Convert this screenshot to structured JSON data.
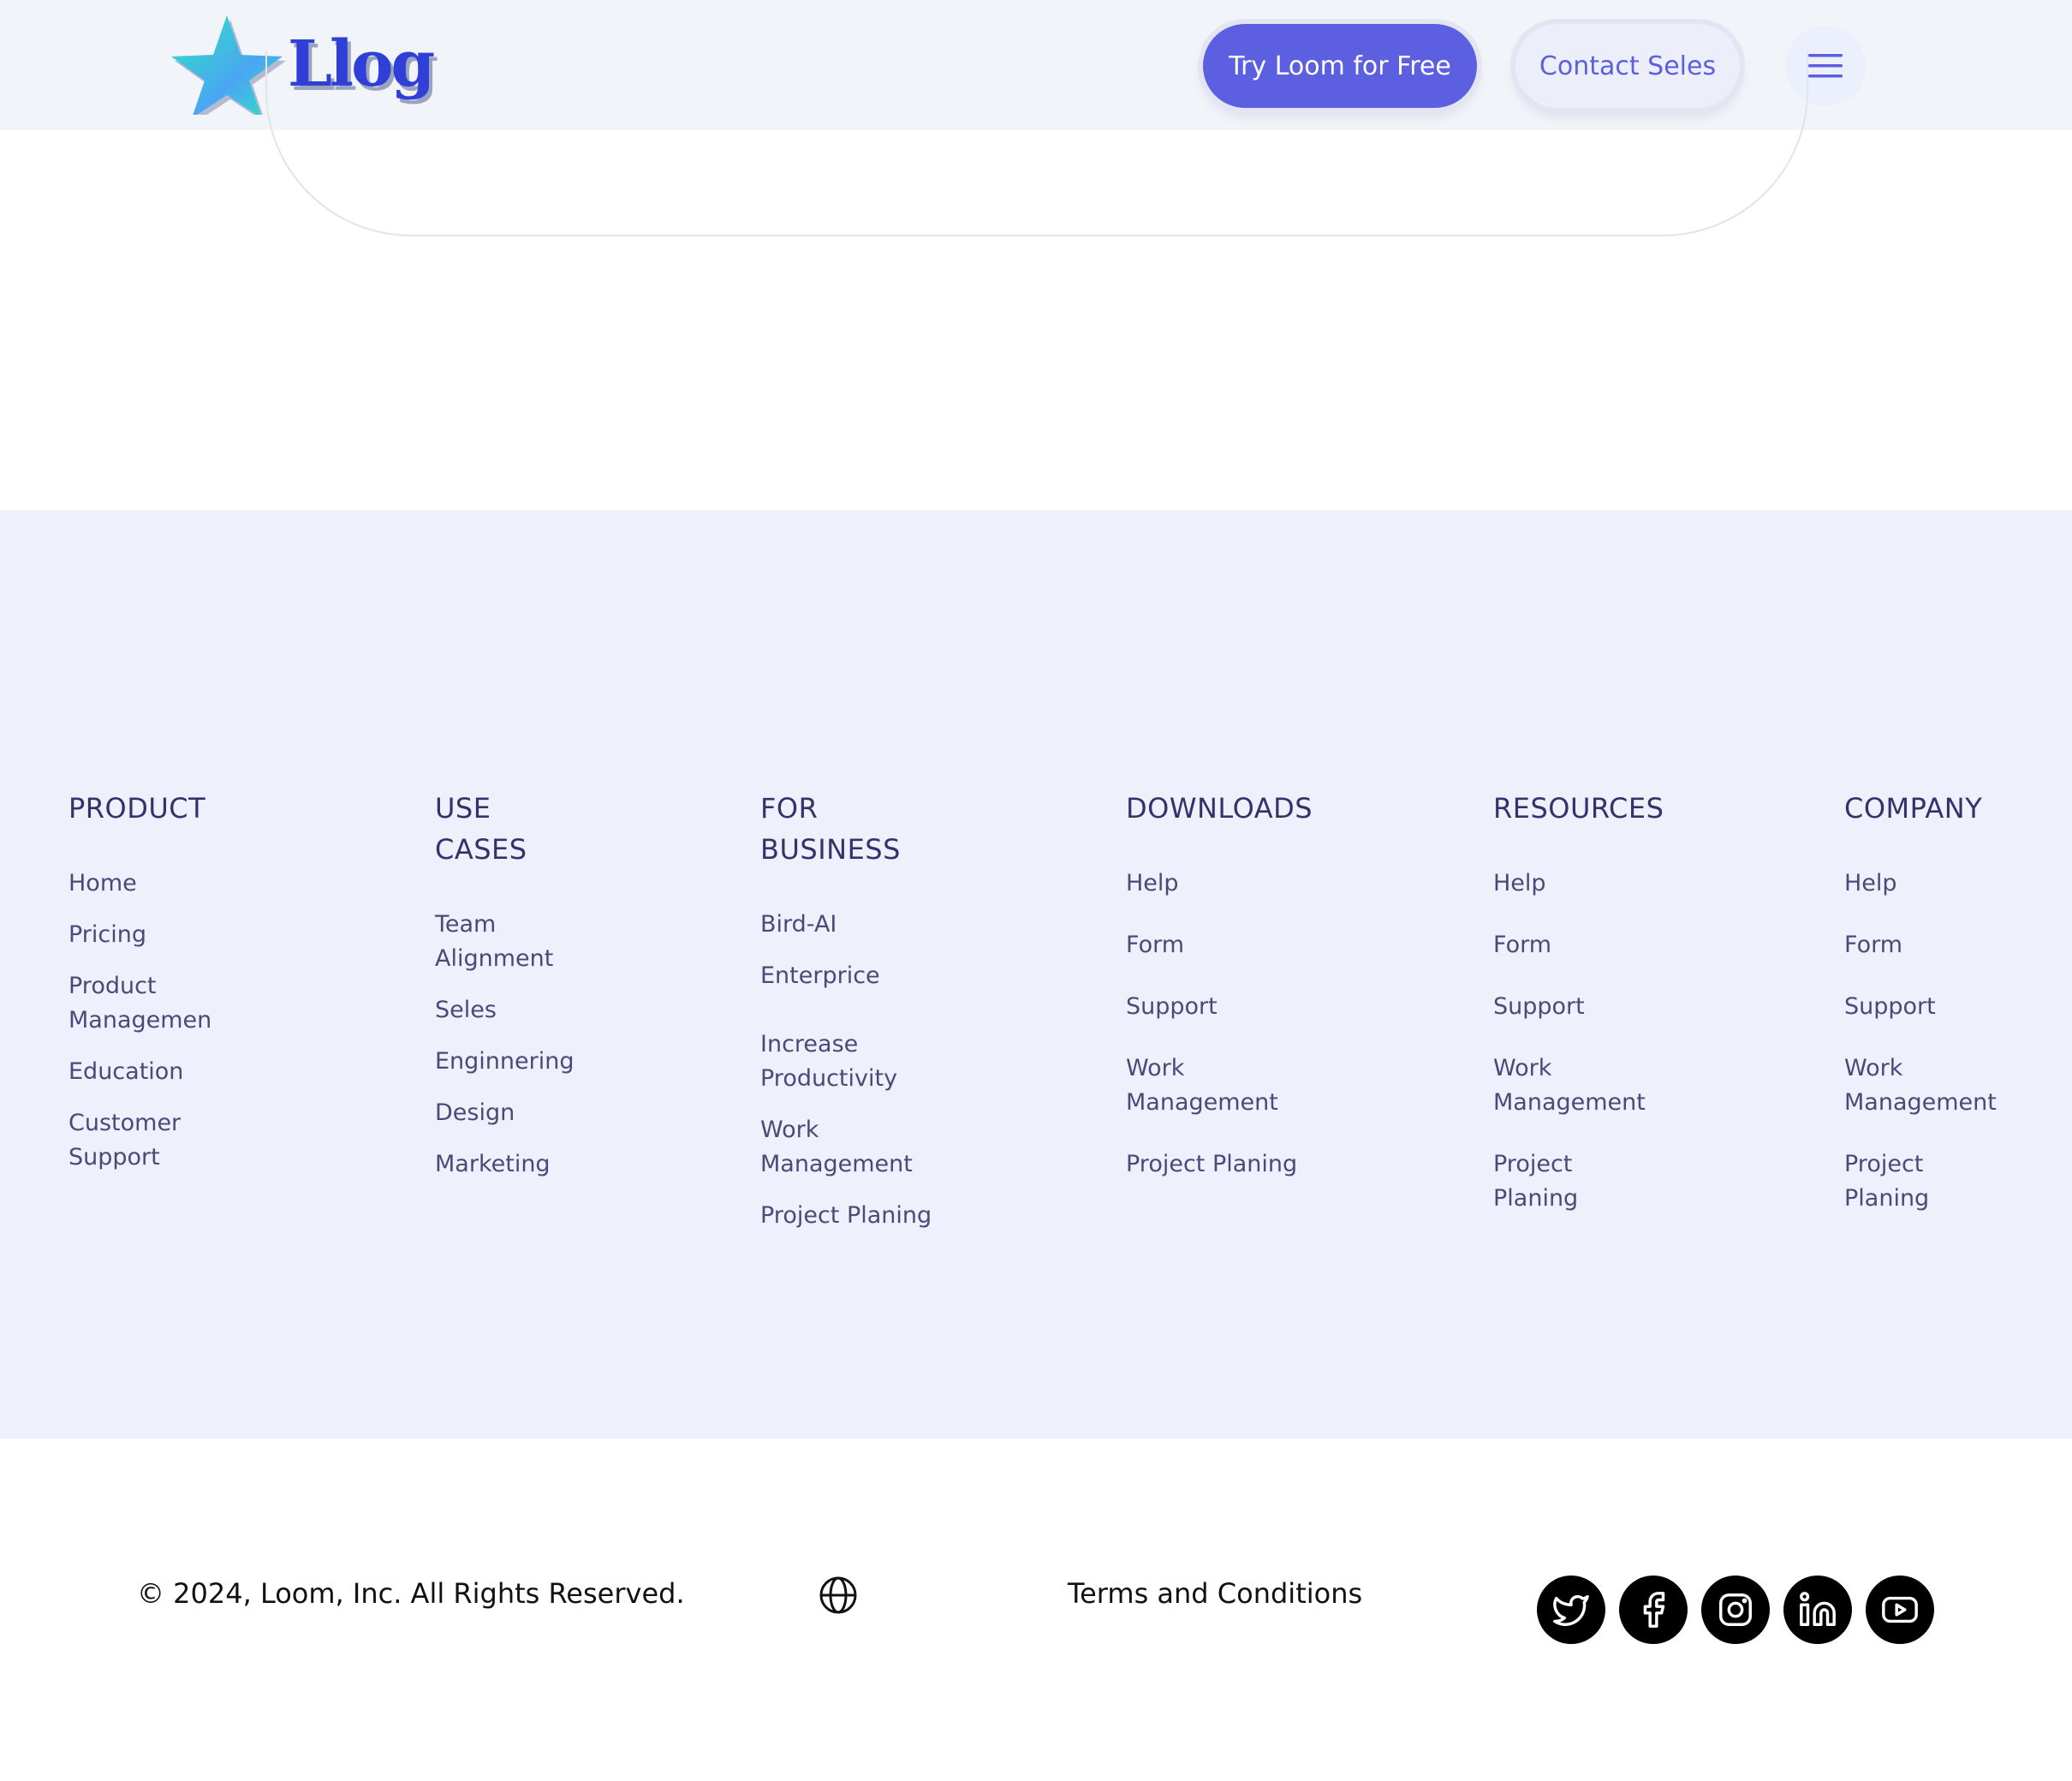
{
  "header": {
    "logo_text": "Llog",
    "try_button": "Try Loom for Free",
    "contact_button": "Contact Seles",
    "menu_icon": "hamburger-menu-icon"
  },
  "colors": {
    "primary": "#5b5fe0",
    "footer_bg": "#eef0fc",
    "header_bg": "#f1f4f9",
    "heading": "#33326b",
    "link": "#4a4a78"
  },
  "footer": {
    "columns": [
      {
        "title": [
          "PRODUCT"
        ],
        "items": [
          [
            "Home"
          ],
          [
            "Pricing"
          ],
          [
            "Product",
            "Managemen"
          ],
          [
            "Education"
          ],
          [
            "Customer",
            "Support"
          ]
        ]
      },
      {
        "title": [
          "USE",
          "CASES"
        ],
        "items": [
          [
            "Team",
            "Alignment"
          ],
          [
            "Seles"
          ],
          [
            "Enginnering"
          ],
          [
            "Design"
          ],
          [
            "Marketing"
          ]
        ]
      },
      {
        "title": [
          "FOR",
          "BUSINESS"
        ],
        "items": [
          [
            "Bird-AI"
          ],
          [
            "Enterprice"
          ],
          [
            "Increase",
            "Productivity"
          ],
          [
            "Work",
            "Management"
          ],
          [
            "Project Planing"
          ]
        ]
      },
      {
        "title": [
          "DOWNLOADS"
        ],
        "items": [
          [
            "Help"
          ],
          [
            "Form"
          ],
          [
            "Support"
          ],
          [
            "Work",
            "Management"
          ],
          [
            "Project Planing"
          ]
        ]
      },
      {
        "title": [
          "RESOURCES"
        ],
        "items": [
          [
            "Help"
          ],
          [
            "Form"
          ],
          [
            "Support"
          ],
          [
            "Work",
            "Management"
          ],
          [
            "Project",
            "Planing"
          ]
        ]
      },
      {
        "title": [
          "COMPANY"
        ],
        "items": [
          [
            "Help"
          ],
          [
            "Form"
          ],
          [
            "Support"
          ],
          [
            "Work",
            "Management"
          ],
          [
            "Project",
            "Planing"
          ]
        ]
      }
    ]
  },
  "bottom": {
    "copyright": "© 2024, Loom, Inc. All Rights Reserved.",
    "language_icon": "globe-icon",
    "terms": "Terms and Conditions",
    "social": [
      "twitter-icon",
      "facebook-icon",
      "instagram-icon",
      "linkedin-icon",
      "youtube-icon"
    ]
  }
}
